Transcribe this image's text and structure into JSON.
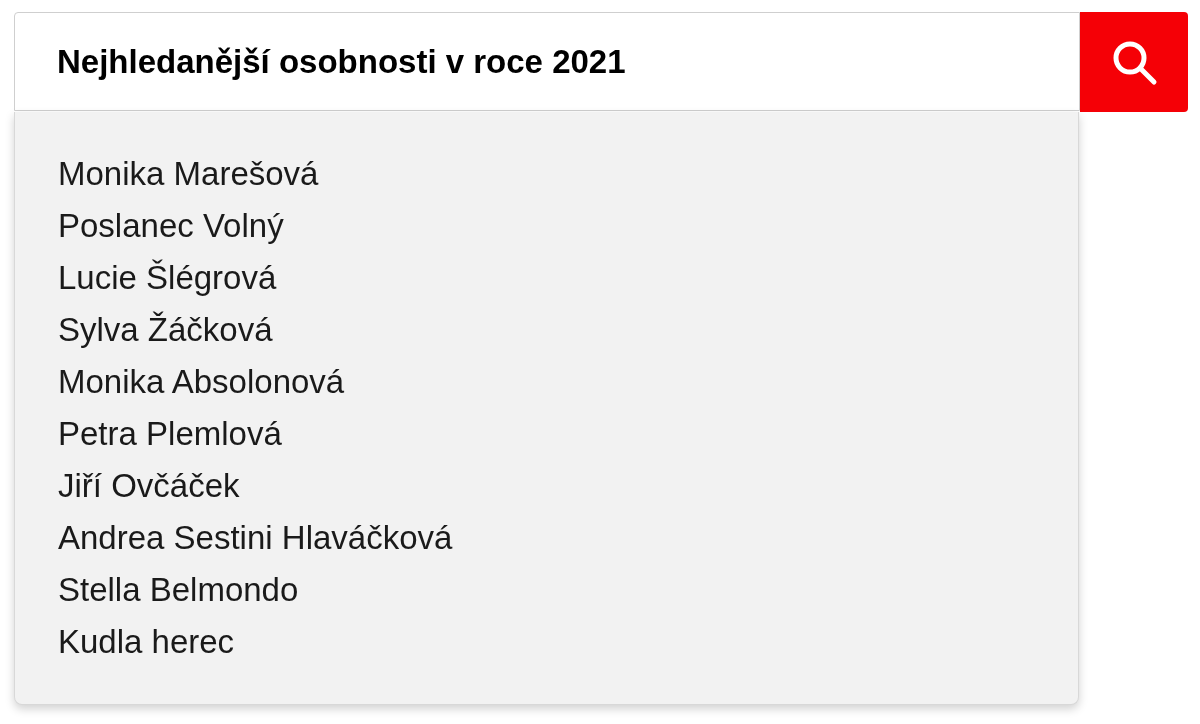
{
  "search": {
    "value": "Nejhledanější osobnosti v roce 2021"
  },
  "suggestions": [
    {
      "label": "Monika Marešová"
    },
    {
      "label": "Poslanec Volný"
    },
    {
      "label": "Lucie Šlégrová"
    },
    {
      "label": "Sylva Žáčková"
    },
    {
      "label": "Monika Absolonová"
    },
    {
      "label": "Petra Plemlová"
    },
    {
      "label": "Jiří Ovčáček"
    },
    {
      "label": "Andrea Sestini Hlaváčková"
    },
    {
      "label": "Stella Belmondo"
    },
    {
      "label": "Kudla herec"
    }
  ]
}
